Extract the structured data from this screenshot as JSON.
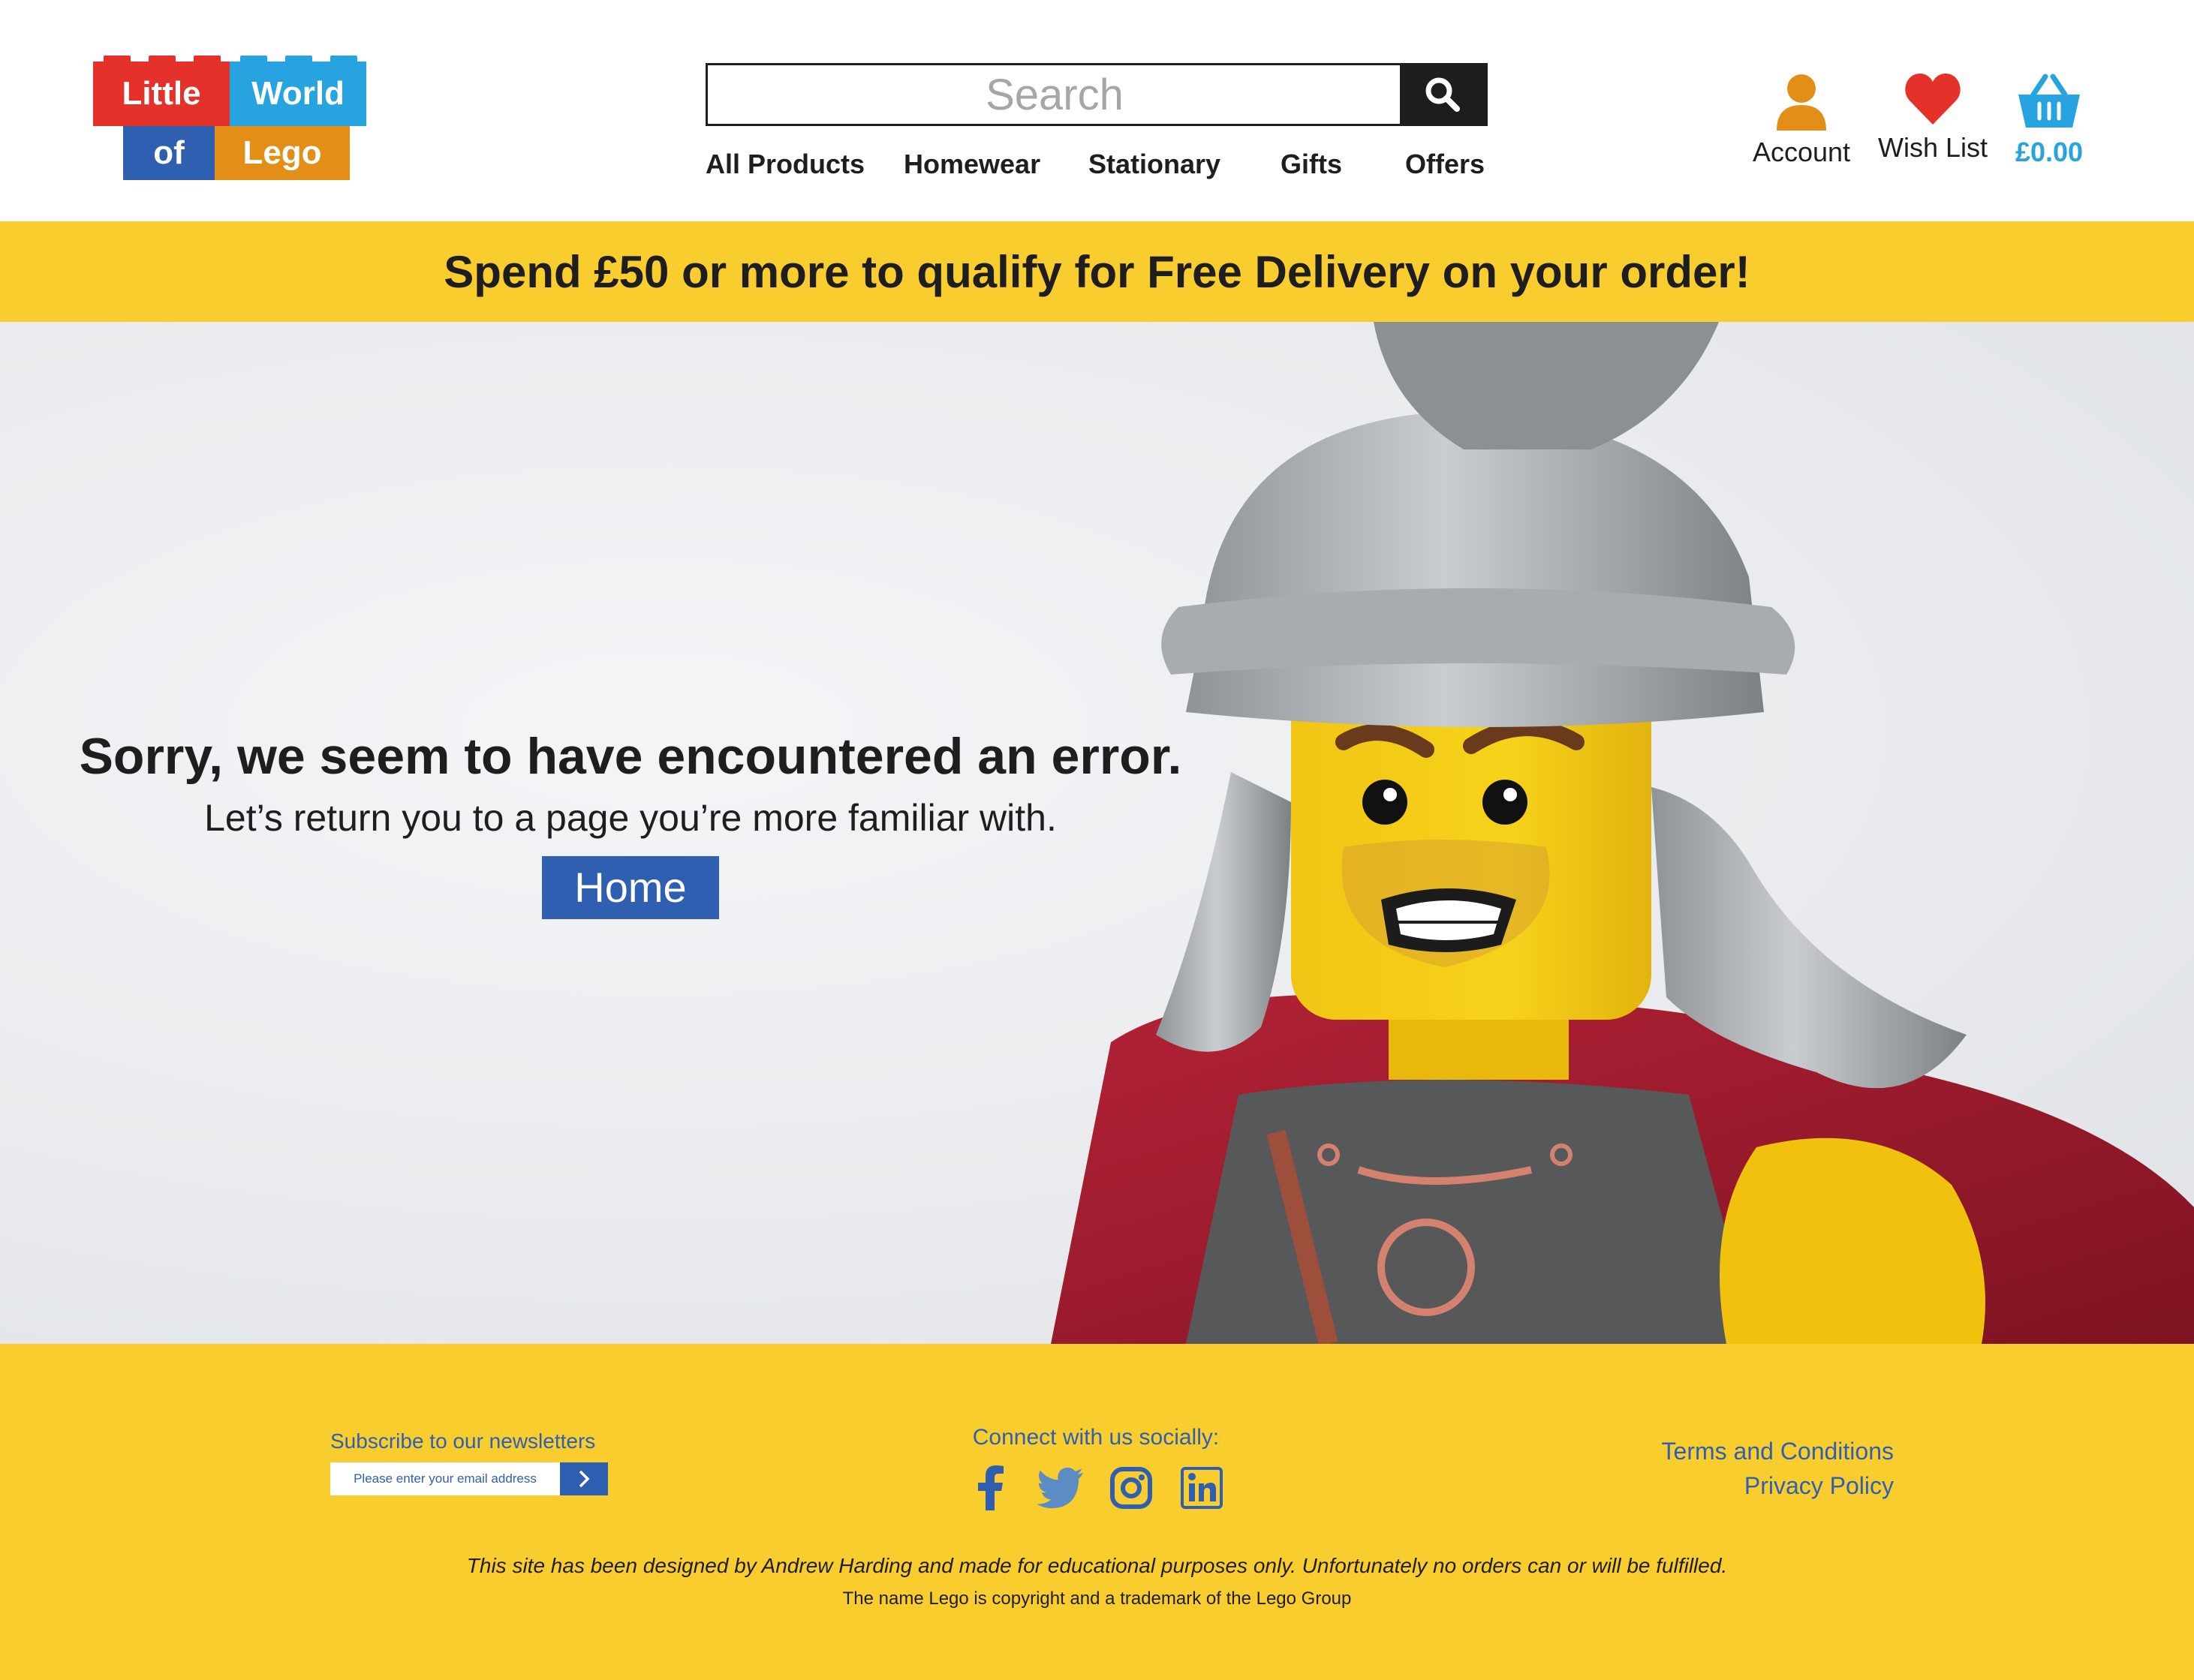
{
  "logo": {
    "words": [
      "Little",
      "World",
      "of",
      "Lego"
    ],
    "colors": [
      "#e4322b",
      "#27a3df",
      "#2f5fb1",
      "#e38f17"
    ]
  },
  "header": {
    "search_placeholder": "Search",
    "nav": [
      "All Products",
      "Homewear",
      "Stationary",
      "Gifts",
      "Offers"
    ],
    "account_label": "Account",
    "wishlist_label": "Wish List",
    "basket_total": "£0.00"
  },
  "banner": {
    "text": "Spend £50 or more to qualify for Free Delivery on your order!"
  },
  "hero": {
    "heading": "Sorry, we seem to have encountered an error.",
    "subheading": "Let’s return you to a page you’re more familiar with.",
    "home_button": "Home",
    "image": "lego-roman-soldier-minifigure"
  },
  "footer": {
    "newsletter_label": "Subscribe to our newsletters",
    "email_placeholder": "Please enter your email address",
    "social_label": "Connect with us socially:",
    "social_icons": [
      "facebook-icon",
      "twitter-icon",
      "instagram-icon",
      "linkedin-icon"
    ],
    "terms_link": "Terms and Conditions",
    "privacy_link": "Privacy Policy",
    "disclaimer": "This site has been designed by Andrew Harding and made for educational purposes only. Unfortunately no orders can or will be fulfilled.",
    "copyright": "The name Lego is copyright and a trademark of the Lego Group"
  },
  "colors": {
    "accent_yellow": "#facd2f",
    "brand_blue": "#2f5fb1",
    "basket_blue": "#27a3df",
    "heart_red": "#e4322b",
    "account_orange": "#e38f17"
  }
}
